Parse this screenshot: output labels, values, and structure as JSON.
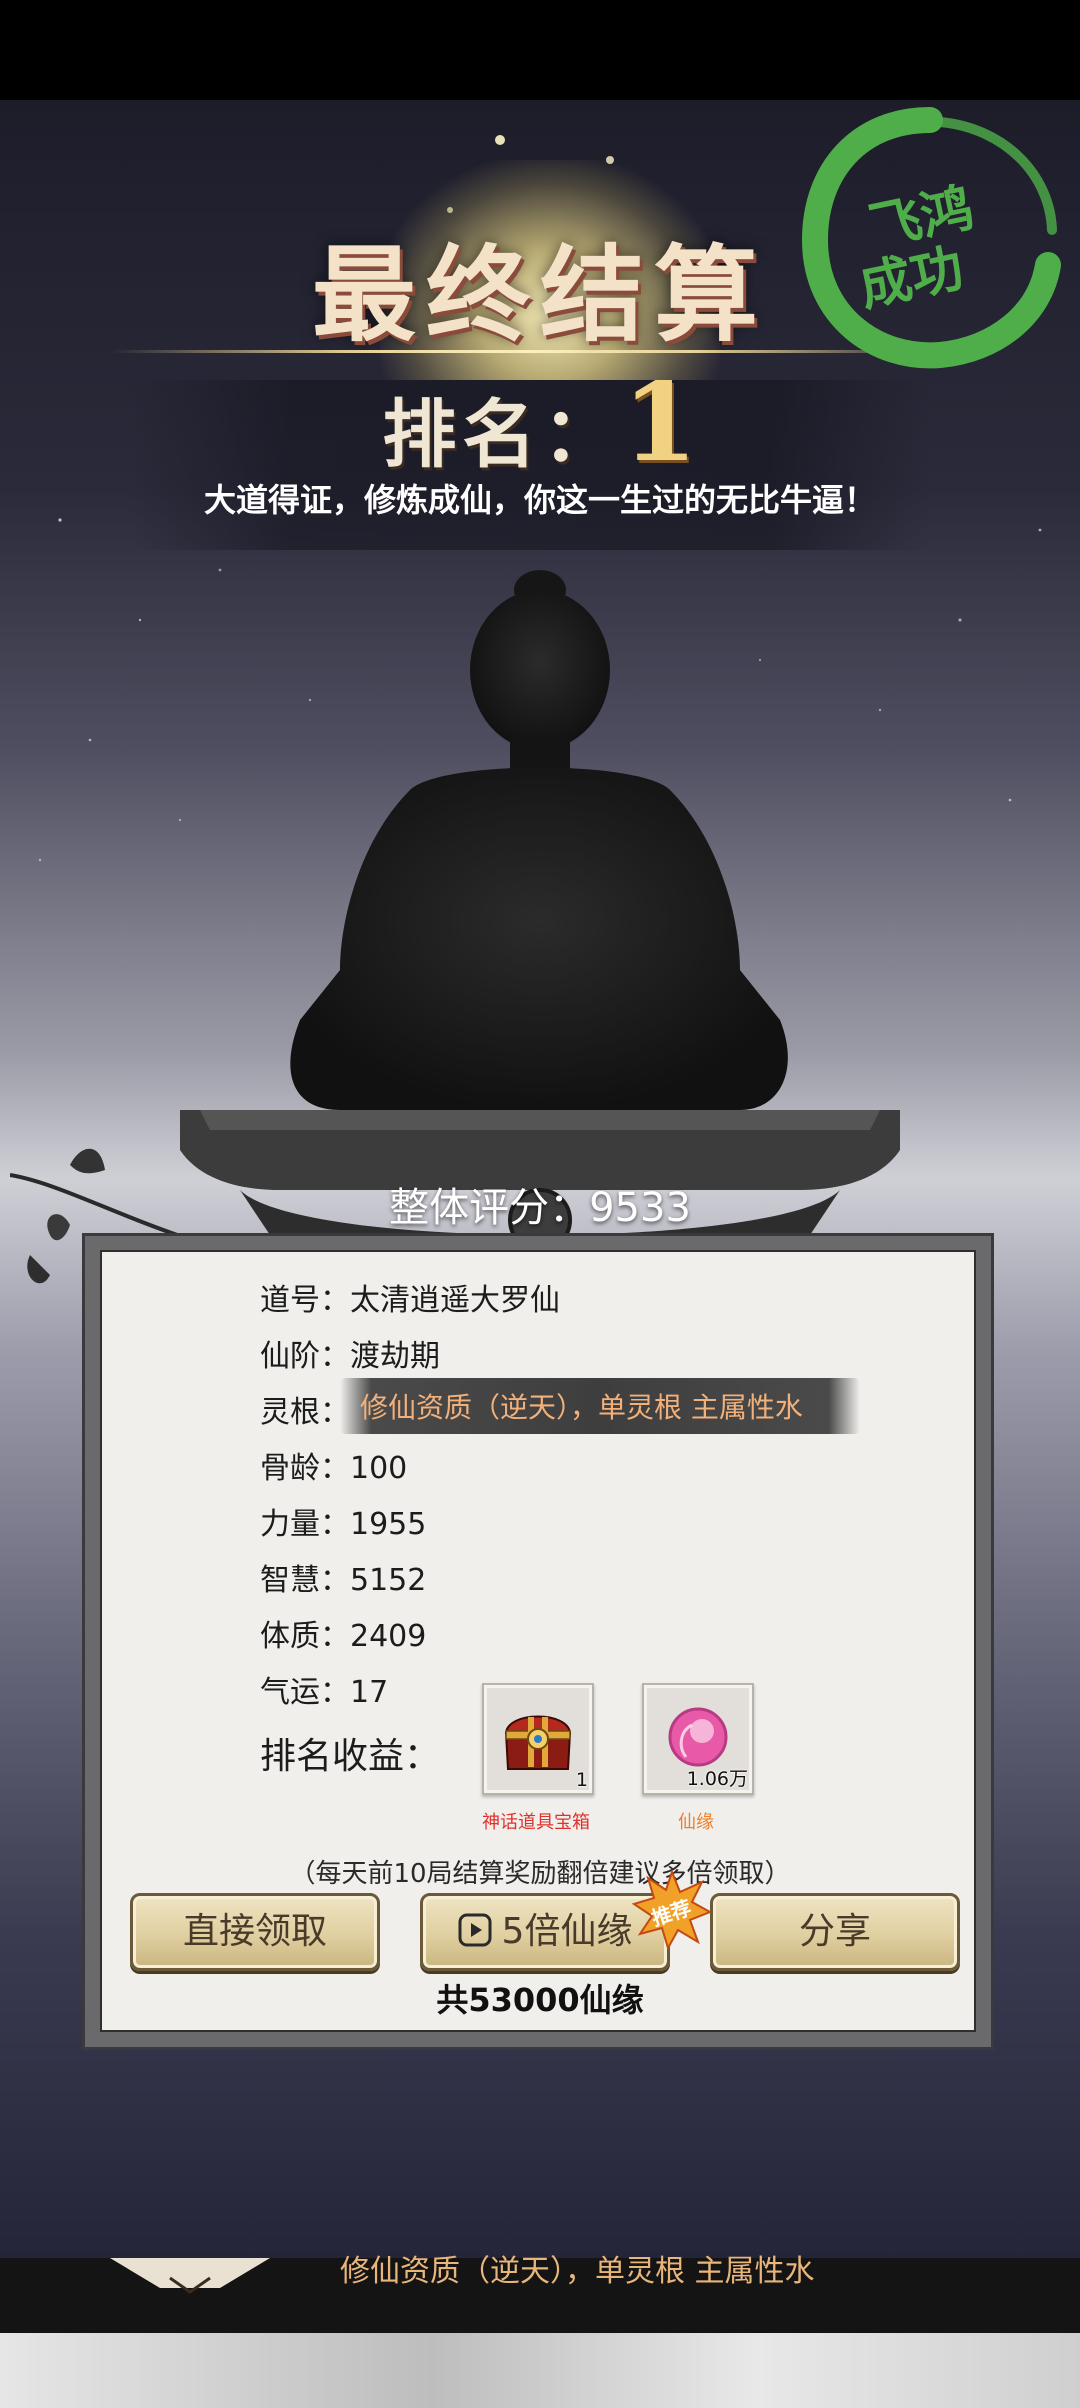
{
  "header": {
    "final_title": "最终结算",
    "rank_label": "排名：",
    "rank_value": "1",
    "subtitle": "大道得证，修炼成仙，你这一生过的无比牛逼！",
    "seal_text_line1": "飞鸿",
    "seal_text_line2": "成功"
  },
  "score": {
    "label": "整体评分：",
    "value": "9533"
  },
  "attributes": {
    "title_key": "道号：",
    "title_val": "太清逍遥大罗仙",
    "stage_key": "仙阶：",
    "stage_val": "渡劫期",
    "root_key": "灵根：",
    "root_val": "修仙资质（逆天），单灵根 主属性水",
    "age_key": "骨龄：",
    "age_val": "100",
    "power_key": "力量：",
    "power_val": "1955",
    "wisdom_key": "智慧：",
    "wisdom_val": "5152",
    "body_key": "体质：",
    "body_val": "2409",
    "luck_key": "气运：",
    "luck_val": "17"
  },
  "rewards": {
    "label": "排名收益：",
    "items": [
      {
        "name": "神话道具宝箱",
        "count": "1",
        "name_color": "#e0322b",
        "icon": "treasure-chest-icon"
      },
      {
        "name": "仙缘",
        "count": "1.06万",
        "name_color": "#ee7f2a",
        "icon": "pink-orb-icon"
      }
    ]
  },
  "note": "（每天前10局结算奖励翻倍建议多倍领取）",
  "buttons": {
    "claim": "直接领取",
    "multi": "5倍仙缘",
    "share": "分享",
    "badge": "推荐"
  },
  "total": "共53000仙缘",
  "bottom_strip_text": "修仙资质（逆天），单灵根 主属性水",
  "colors": {
    "accent_gold": "#f1d283",
    "seal_green": "#4fae4a",
    "root_text": "#f2b07a"
  }
}
